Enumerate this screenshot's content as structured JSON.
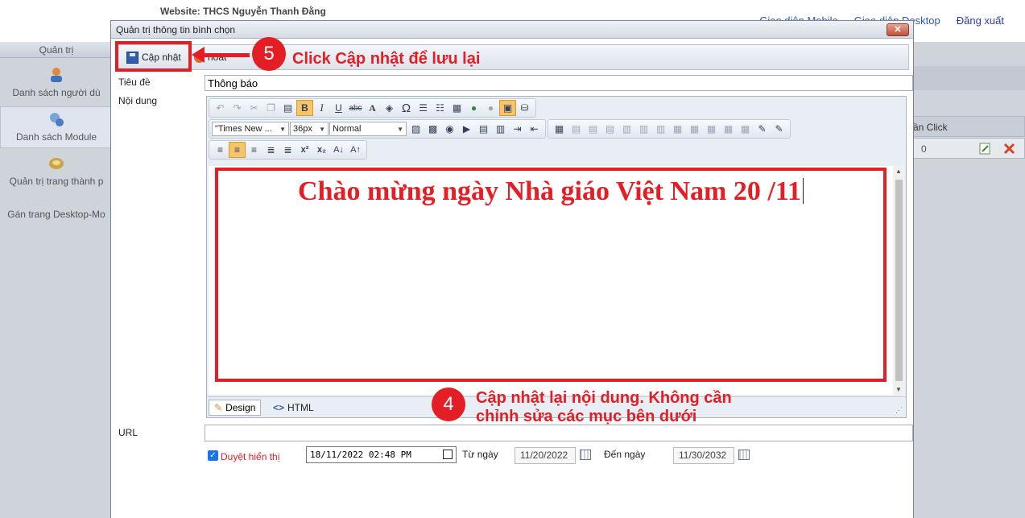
{
  "site": {
    "title": "Website: THCS Nguyễn Thanh Đằng",
    "nav": [
      "Giao diện Mobile",
      "Giao diện Desktop",
      "Đăng xuất"
    ]
  },
  "sidebar": {
    "header": "Quản trị",
    "items": [
      {
        "label": "Danh sách người dù"
      },
      {
        "label": "Danh sách Module"
      },
      {
        "label": "Quản trị trang thành p"
      },
      {
        "label": "Gán trang Desktop-Mo"
      }
    ]
  },
  "background_table": {
    "column": "ần Click",
    "value": "0"
  },
  "dialog": {
    "title": "Quản trị thông tin bình chọn",
    "close_label": "✕",
    "save_label": "Cập nhật",
    "cancel_label": "hoát",
    "title_label": "Tiêu đề",
    "title_value": "Thông báo",
    "content_label": "Nội dung",
    "url_label": "URL",
    "display_label": "Duyệt hiển thị",
    "datetime_value": "18/11/2022  02:48  PM",
    "from_label": "Từ ngày",
    "from_value": "11/20/2022",
    "to_label": "Đến ngày",
    "to_value": "11/30/2032"
  },
  "editor": {
    "font_name": "\"Times New ...",
    "font_size": "36px",
    "paragraph": "Normal",
    "content_text": "Chào mừng ngày Nhà giáo Việt Nam 20 /11",
    "tab_design": "Design",
    "tab_html": "HTML"
  },
  "annotations": {
    "step5_number": "5",
    "step5_text": "Click Cập nhật để lưu lại",
    "step4_number": "4",
    "step4_line1": "Cập nhật lại nội dung. Không cần",
    "step4_line2": "chỉnh sửa các mục bên dưới",
    "highlight_color": "#e31e24"
  }
}
